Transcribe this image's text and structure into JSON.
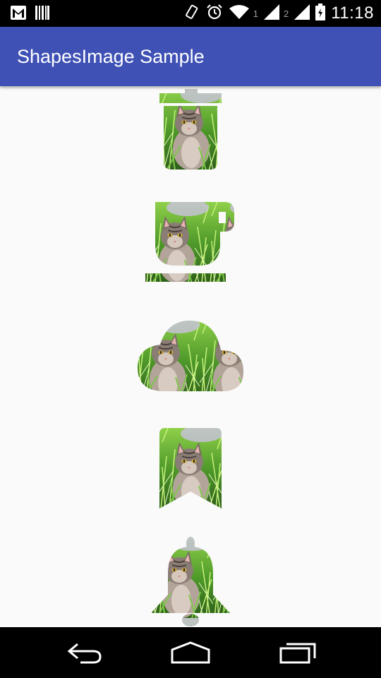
{
  "status_bar": {
    "time": "11:18",
    "sim1_label": "1",
    "sim2_label": "2",
    "icons": [
      "gmail-icon",
      "barcode-icon",
      "vibrate-icon",
      "alarm-icon",
      "wifi-icon",
      "signal-icon",
      "signal-icon",
      "battery-icon"
    ]
  },
  "app_bar": {
    "title": "ShapesImage Sample"
  },
  "shapes": [
    {
      "name": "trash-can-shape"
    },
    {
      "name": "coffee-cup-shape"
    },
    {
      "name": "cloud-shape"
    },
    {
      "name": "bookmark-shape"
    },
    {
      "name": "bell-shape"
    }
  ],
  "nav_bar": {
    "buttons": [
      "back-icon",
      "home-icon",
      "recent-apps-icon"
    ]
  },
  "colors": {
    "status_bar": "#000000",
    "app_bar": "#3f51b5",
    "background": "#fafafa",
    "grass": "#5aa72c",
    "cat_fur": "#9a8f86"
  }
}
